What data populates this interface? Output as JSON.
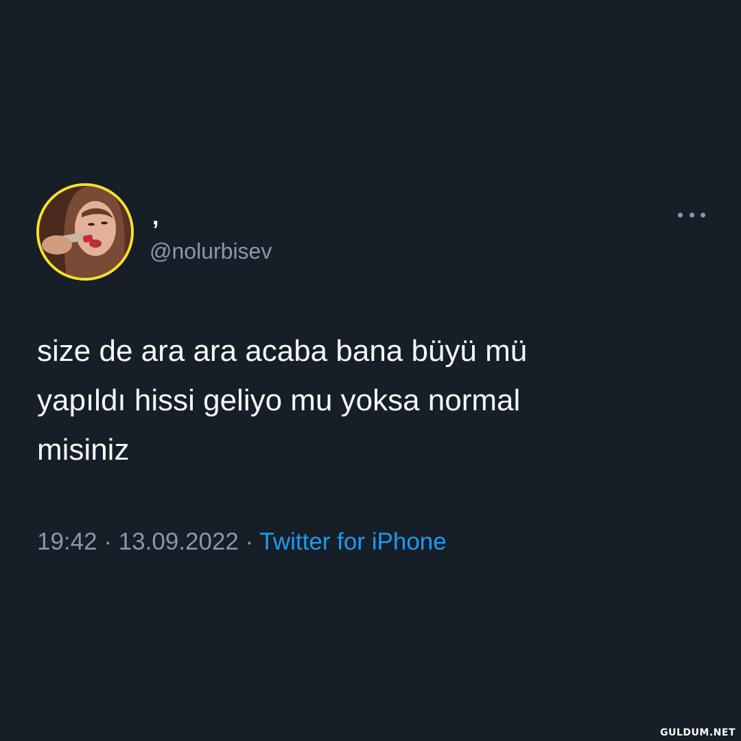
{
  "tweet": {
    "display_name": ",",
    "handle": "@nolurbisev",
    "text": "size de ara ara acaba bana büyü mü\nyapıldı hissi geliyo mu yoksa normal\nmisiniz",
    "time": "19:42",
    "separator": "·",
    "date": "13.09.2022",
    "source": "Twitter for iPhone"
  },
  "icons": {
    "more": "more-horizontal-icon"
  },
  "watermark": "GULDUM.NET",
  "colors": {
    "background": "#161e28",
    "avatar_border": "#f4e22e",
    "secondary_text": "#8b98a5",
    "link": "#1d9bf0"
  }
}
